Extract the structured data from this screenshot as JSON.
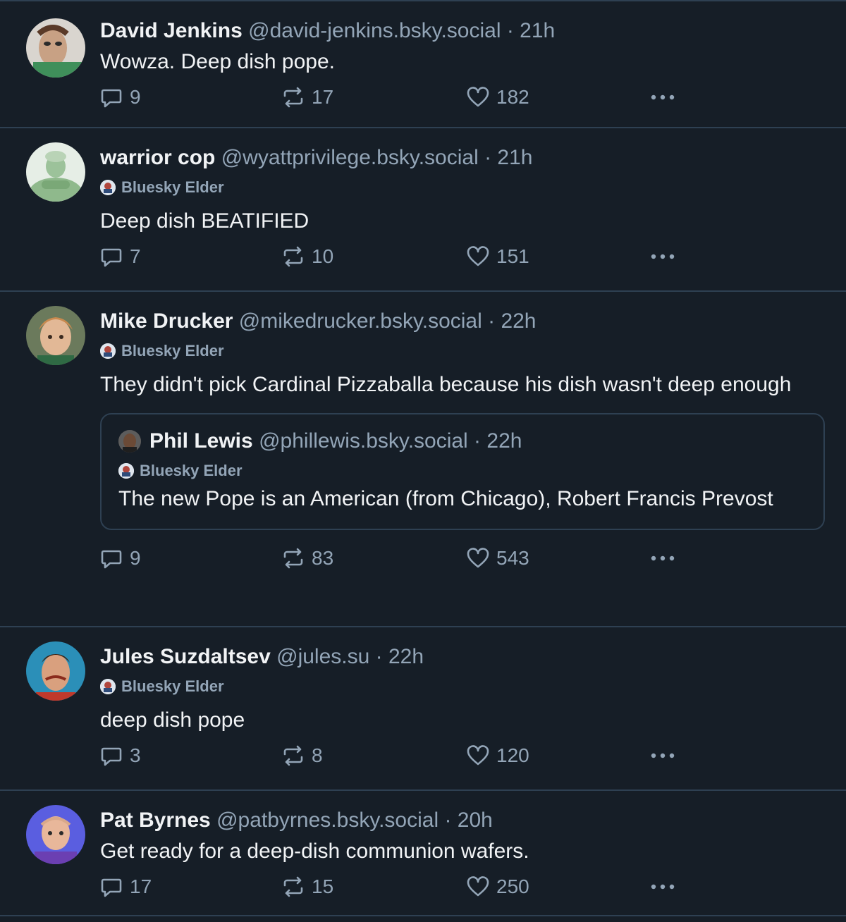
{
  "badge_label": "Bluesky Elder",
  "posts": [
    {
      "name": "David Jenkins",
      "handle": "@david-jenkins.bsky.social · 21h",
      "text": "Wowza. Deep dish pope.",
      "replies": "9",
      "reposts": "17",
      "likes": "182"
    },
    {
      "name": "warrior cop",
      "handle": "@wyattprivilege.bsky.social · 21h",
      "text": "Deep dish BEATIFIED",
      "replies": "7",
      "reposts": "10",
      "likes": "151"
    },
    {
      "name": "Mike Drucker",
      "handle": "@mikedrucker.bsky.social · 22h",
      "text": "They didn't pick Cardinal Pizzaballa because his dish wasn't deep enough",
      "quote": {
        "name": "Phil Lewis",
        "handle": "@phillewis.bsky.social · 22h",
        "text": "The new Pope is an American (from Chicago), Robert Francis Prevost"
      },
      "replies": "9",
      "reposts": "83",
      "likes": "543"
    },
    {
      "name": "Jules Suzdaltsev",
      "handle": "@jules.su · 22h",
      "text": "deep dish pope",
      "replies": "3",
      "reposts": "8",
      "likes": "120"
    },
    {
      "name": "Pat Byrnes",
      "handle": "@patbyrnes.bsky.social · 20h",
      "text": "Get ready for a deep-dish communion wafers.",
      "replies": "17",
      "reposts": "15",
      "likes": "250"
    }
  ],
  "colors": {
    "background": "#161e27",
    "muted": "#93a5b7",
    "divider": "#2e4052",
    "text": "#f1f3f5"
  }
}
